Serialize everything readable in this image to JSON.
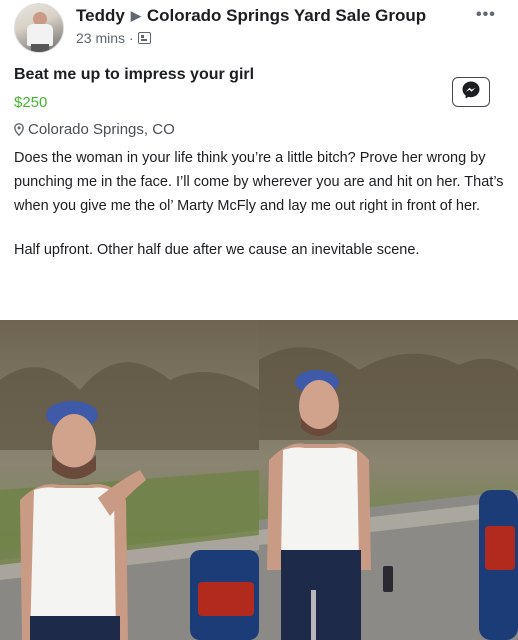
{
  "post": {
    "author": "Teddy",
    "group": "Colorado Springs Yard Sale Group",
    "time": "23 mins",
    "time_separator": "·"
  },
  "listing": {
    "title": "Beat me up to impress your girl",
    "price": "$250",
    "location": "Colorado Springs, CO",
    "description": [
      "Does the woman in your life think you’re a little bitch? Prove her wrong by punching me in the face. I’ll come by wherever you are and hit on her. That’s when you give me the ol’ Marty McFly and lay me out right in front of her.",
      "Half upfront. Other half due after we cause an inevitable scene."
    ]
  },
  "icons": {
    "more": "more-options-icon",
    "messenger": "messenger-icon",
    "location": "location-pin-icon",
    "group": "group-icon",
    "arrow": "right-arrow-icon"
  },
  "colors": {
    "price": "#42b72a",
    "secondary_text": "#606770"
  }
}
